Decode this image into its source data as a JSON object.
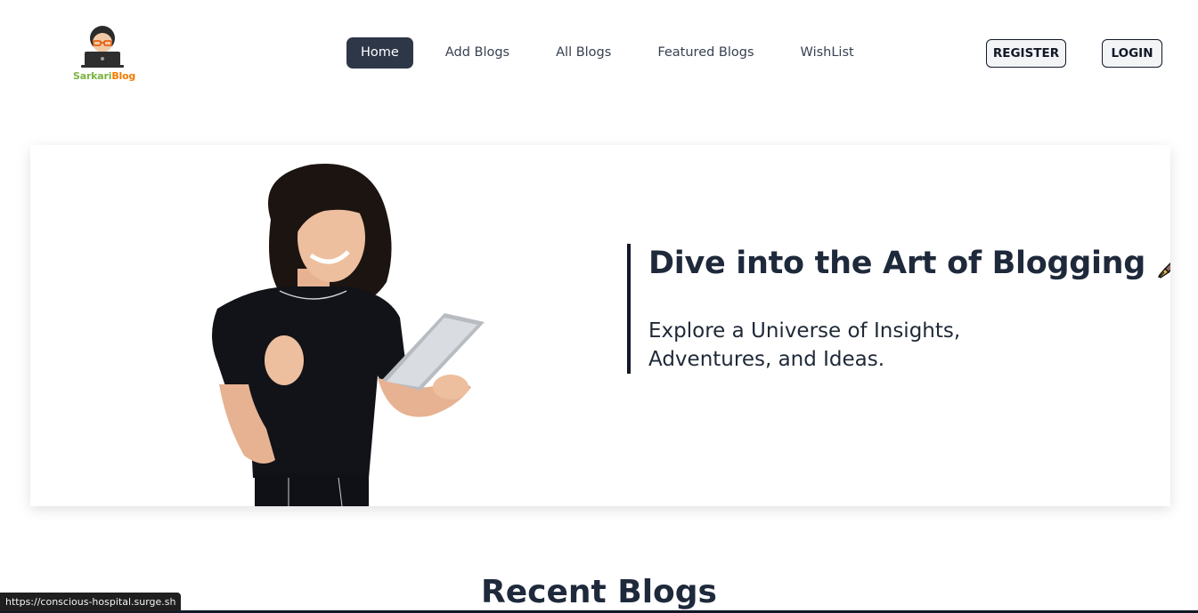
{
  "logo": {
    "part1": "Sarkari",
    "part2": "Blog"
  },
  "nav": {
    "items": [
      {
        "label": "Home",
        "active": true
      },
      {
        "label": "Add Blogs"
      },
      {
        "label": "All Blogs"
      },
      {
        "label": "Featured Blogs"
      },
      {
        "label": "WishList"
      }
    ]
  },
  "auth": {
    "register": "REGISTER",
    "login": "LOGIN"
  },
  "hero": {
    "title": "Dive into the Art of Blogging",
    "subtitle": "Explore a Universe of Insights, Adventures, and Ideas.",
    "icon": "fountain-pen-icon"
  },
  "section": {
    "recent_title": "Recent Blogs"
  },
  "status": {
    "url": "https://conscious-hospital.surge.sh"
  },
  "colors": {
    "active_nav": "#2d3748",
    "logo_green": "#7cb342",
    "logo_orange": "#f57c00"
  }
}
